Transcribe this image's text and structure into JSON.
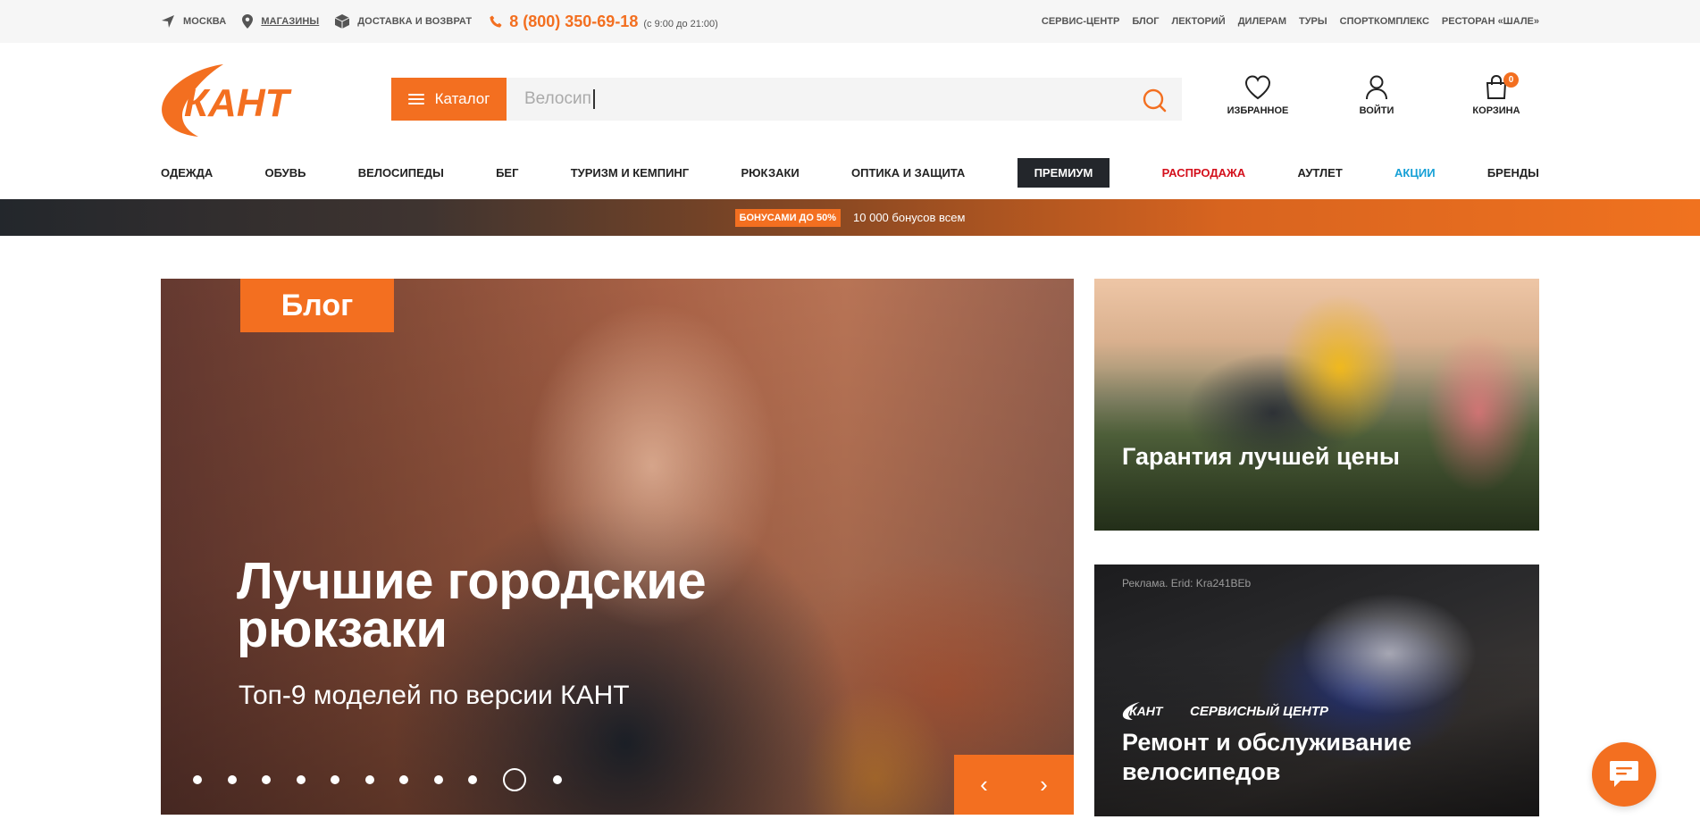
{
  "topbar": {
    "city": "МОСКВА",
    "stores": "МАГАЗИНЫ",
    "delivery": "ДОСТАВКА И ВОЗВРАТ",
    "phone": "8 (800) 350-69-18",
    "hours": "(с 9:00 до 21:00)",
    "links": [
      "СЕРВИС-ЦЕНТР",
      "БЛОГ",
      "ЛЕКТОРИЙ",
      "ДИЛЕРАМ",
      "ТУРЫ",
      "СПОРТКОМПЛЕКС",
      "РЕСТОРАН «ШАЛЕ»"
    ]
  },
  "header": {
    "logo_text": "КАНТ",
    "catalog_label": "Каталог",
    "search_value": "Велосип",
    "favorites_label": "ИЗБРАННОЕ",
    "login_label": "ВОЙТИ",
    "cart_label": "КОРЗИНА",
    "cart_count": "0"
  },
  "nav": {
    "items": [
      "ОДЕЖДА",
      "ОБУВЬ",
      "ВЕЛОСИПЕДЫ",
      "БЕГ",
      "ТУРИЗМ И КЕМПИНГ",
      "РЮКЗАКИ",
      "ОПТИКА И ЗАЩИТА",
      "ПРЕМИУМ",
      "РАСПРОДАЖА",
      "АУТЛЕТ",
      "АКЦИИ",
      "БРЕНДЫ"
    ]
  },
  "promo": {
    "badge": "БОНУСАМИ ДО 50%",
    "text": "10 000 бонусов всем"
  },
  "hero": {
    "tag": "Блог",
    "title": "Лучшие городские рюкзаки",
    "subtitle": "Топ-9 моделей по версии КАНТ",
    "slide_count": 11,
    "active_slide": 10,
    "prev": "‹",
    "next": "›"
  },
  "banners": [
    {
      "title": "Гарантия лучшей цены"
    },
    {
      "ad_note": "Реклама. Erid: Kra241BEb",
      "service_brand": "КАНТ",
      "service_label": "СЕРВИСНЫЙ ЦЕНТР",
      "title": "Ремонт и обслуживание велосипедов"
    }
  ],
  "colors": {
    "accent": "#f36f20",
    "sale": "#d4101c",
    "promo": "#16a0d6",
    "premium_bg": "#23262b"
  },
  "icons": {
    "city": "location-arrow-icon",
    "stores": "map-pin-icon",
    "delivery": "box-icon",
    "phone": "phone-icon",
    "search": "search-icon",
    "favorites": "heart-icon",
    "login": "user-icon",
    "cart": "shopping-bag-icon",
    "chat": "chat-icon"
  }
}
